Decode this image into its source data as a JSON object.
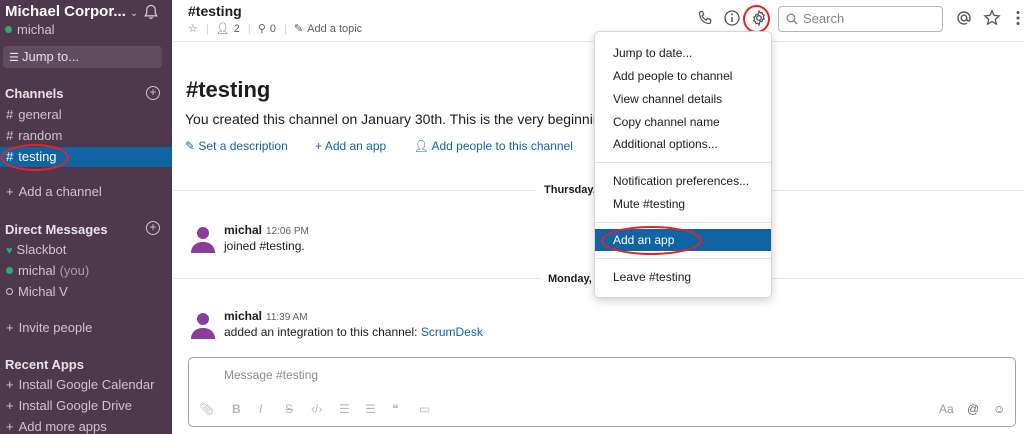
{
  "sidebar": {
    "team_name": "Michael Corpor...",
    "team_caret": "⌄",
    "user": "michal",
    "jump_label": "Jump to...",
    "channels_header": "Channels",
    "channels": [
      {
        "name": "general",
        "active": false
      },
      {
        "name": "random",
        "active": false
      },
      {
        "name": "testing",
        "active": true
      }
    ],
    "add_channel": "Add a channel",
    "dm_header": "Direct Messages",
    "dms": [
      {
        "name": "Slackbot",
        "suffix": ""
      },
      {
        "name": "michal",
        "suffix": "(you)"
      },
      {
        "name": "Michal V",
        "suffix": ""
      }
    ],
    "invite": "Invite people",
    "apps_header": "Recent Apps",
    "apps": [
      "Install Google Calendar",
      "Install Google Drive",
      "Add more apps"
    ]
  },
  "header": {
    "channel_title": "#testing",
    "members": "2",
    "pins": "0",
    "topic": "Add a topic",
    "search_placeholder": "Search"
  },
  "intro": {
    "title": "#testing",
    "text": "You created this channel on January 30th. This is the very beginnin",
    "links": [
      "Set a description",
      "Add an app",
      "Add people to this channel"
    ]
  },
  "days": [
    "Thursday,",
    "Monday,"
  ],
  "messages": [
    {
      "author": "michal",
      "time": "12:06 PM",
      "text": "joined #testing.",
      "link": ""
    },
    {
      "author": "michal",
      "time": "11:39 AM",
      "text": "added an integration to this channel:",
      "link": "ScrumDesk"
    }
  ],
  "composer": {
    "placeholder": "Message #testing",
    "aa": "Aa"
  },
  "menu": {
    "items": [
      "Jump to date...",
      "Add people to channel",
      "View channel details",
      "Copy channel name",
      "Additional options...",
      "Notification preferences...",
      "Mute #testing",
      "Add an app",
      "Leave #testing"
    ],
    "highlighted": "Add an app"
  },
  "colors": {
    "sidebar_bg": "#4d394b",
    "active_blue": "#1164a3",
    "link_blue": "#1264a3",
    "presence_green": "#2bac76",
    "annotation_red": "#e8231f"
  }
}
